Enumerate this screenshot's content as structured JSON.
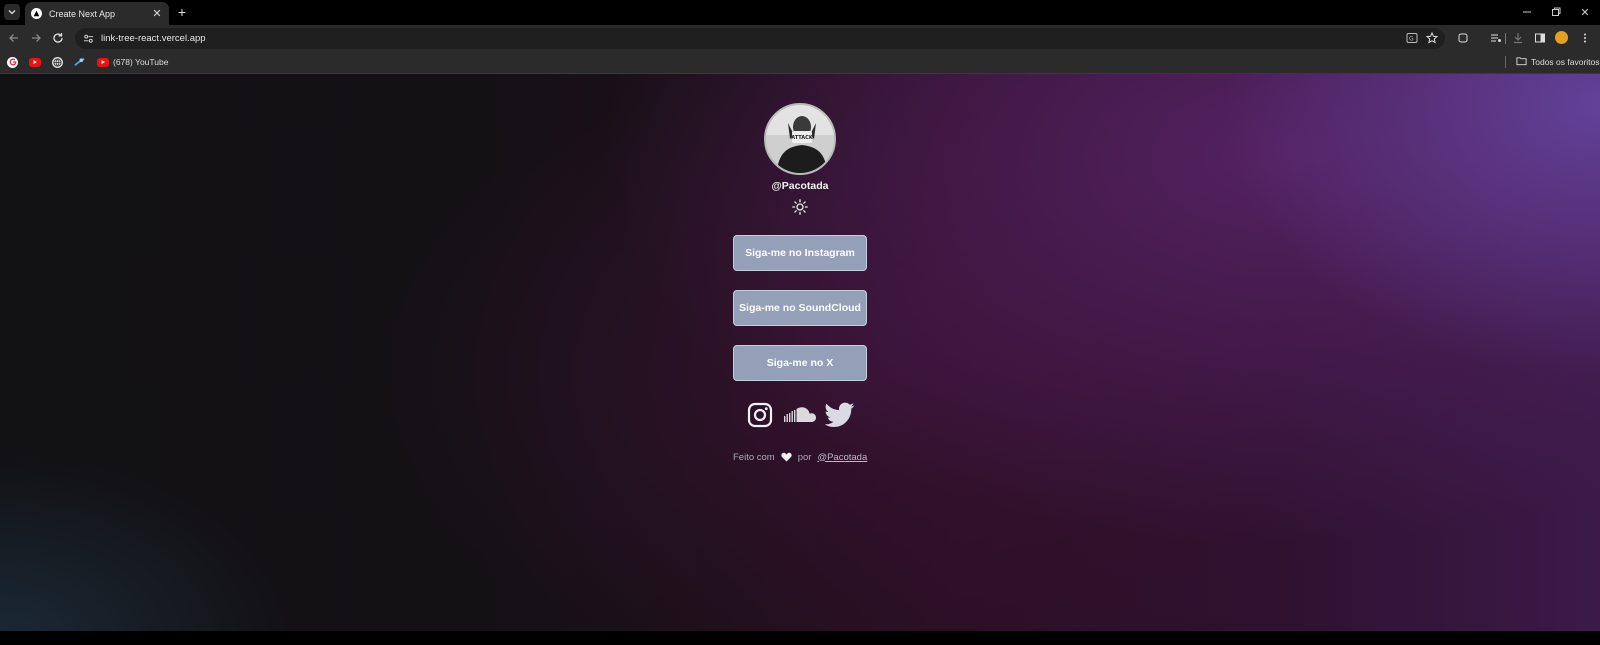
{
  "browser": {
    "tab_title": "Create Next App",
    "url": "link-tree-react.vercel.app",
    "bookmarks": [
      {
        "icon": "google-icon",
        "label": ""
      },
      {
        "icon": "youtube-icon",
        "label": ""
      },
      {
        "icon": "globe-icon",
        "label": ""
      },
      {
        "icon": "steam-icon",
        "label": ""
      },
      {
        "icon": "youtube-icon",
        "label": "(678) YouTube"
      }
    ],
    "all_bookmarks_label": "Todos os favoritos"
  },
  "profile": {
    "handle": "@Pacotada"
  },
  "links": [
    {
      "label": "Siga-me no Instagram"
    },
    {
      "label": "Siga-me no SoundCloud"
    },
    {
      "label": "Siga-me no X"
    }
  ],
  "socials": [
    "instagram-icon",
    "soundcloud-icon",
    "twitter-icon"
  ],
  "footer": {
    "prefix": "Feito com",
    "middle": "por",
    "author": "@Pacotada"
  },
  "colors": {
    "button_bg": "#94a0b8",
    "gradient_purple": "#5a2a6e",
    "page_dark": "#121114"
  }
}
